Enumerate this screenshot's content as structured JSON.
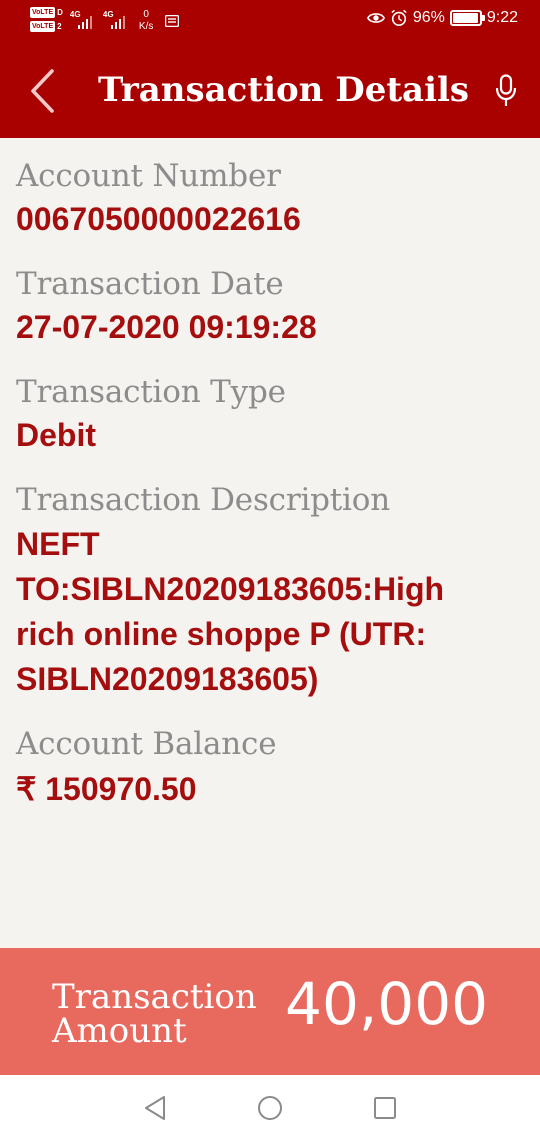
{
  "status_bar": {
    "volte_1": "VoLTE",
    "volte_1_slot": "D",
    "volte_2": "VoLTE",
    "volte_2_slot": "2",
    "network_1": "4G",
    "network_2": "4G",
    "speed_value": "0",
    "speed_unit": "K/s",
    "battery_percent": "96%",
    "battery_level": 0.96,
    "time": "9:22",
    "icons": [
      "eye-icon",
      "alarm-icon",
      "notification-icon",
      "battery-icon"
    ]
  },
  "header": {
    "title": "Transaction Details",
    "back_icon": "chevron-left-icon",
    "mic_icon": "microphone-icon"
  },
  "details": [
    {
      "label": "Account Number",
      "value": "0067050000022616"
    },
    {
      "label": "Transaction Date",
      "value": "27-07-2020 09:19:28"
    },
    {
      "label": "Transaction Type",
      "value": "Debit"
    },
    {
      "label": "Transaction Description",
      "value": "NEFT TO:SIBLN20209183605:High rich online shoppe P (UTR: SIBLN20209183605)"
    },
    {
      "label": "Account Balance",
      "value": "₹ 150970.50"
    }
  ],
  "amount": {
    "label_line1": "Transaction",
    "label_line2": "Amount",
    "value": "40,000"
  },
  "navbar": {
    "icons": [
      "back-triangle-icon",
      "home-circle-icon",
      "recents-square-icon"
    ]
  },
  "colors": {
    "brand": "#a90000",
    "value_text": "#a50e0e",
    "label_text": "#8c8c8c",
    "amount_bar": "#e86a5f",
    "background": "#f5f3f0"
  }
}
